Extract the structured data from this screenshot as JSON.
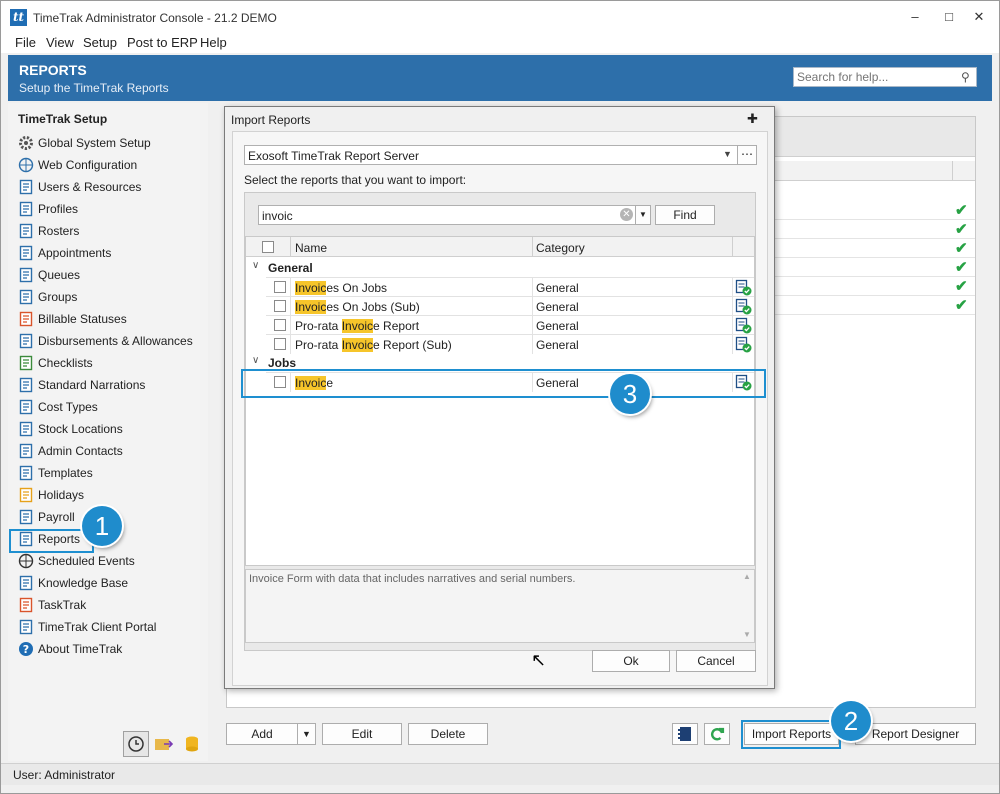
{
  "window": {
    "title": "TimeTrak Administrator Console - 21.2 DEMO",
    "logo": "tt"
  },
  "menu": [
    "File",
    "View",
    "Setup",
    "Post to ERP",
    "Help"
  ],
  "banner": {
    "title": "REPORTS",
    "subtitle": "Setup the TimeTrak Reports",
    "search_placeholder": "Search for help..."
  },
  "sidebar": {
    "title": "TimeTrak Setup",
    "items": [
      {
        "label": "Global System Setup",
        "icon": "gear-icon"
      },
      {
        "label": "Web Configuration",
        "icon": "globe-icon"
      },
      {
        "label": "Users & Resources",
        "icon": "users-icon"
      },
      {
        "label": "Profiles",
        "icon": "profile-icon"
      },
      {
        "label": "Rosters",
        "icon": "roster-icon"
      },
      {
        "label": "Appointments",
        "icon": "calendar-icon"
      },
      {
        "label": "Queues",
        "icon": "queue-icon"
      },
      {
        "label": "Groups",
        "icon": "groups-icon"
      },
      {
        "label": "Billable Statuses",
        "icon": "tag-icon"
      },
      {
        "label": "Disbursements & Allowances",
        "icon": "ledger-icon"
      },
      {
        "label": "Checklists",
        "icon": "checklist-icon"
      },
      {
        "label": "Standard Narrations",
        "icon": "narration-icon"
      },
      {
        "label": "Cost Types",
        "icon": "cost-icon"
      },
      {
        "label": "Stock Locations",
        "icon": "stock-icon"
      },
      {
        "label": "Admin Contacts",
        "icon": "contacts-icon"
      },
      {
        "label": "Templates",
        "icon": "template-icon"
      },
      {
        "label": "Holidays",
        "icon": "holiday-icon"
      },
      {
        "label": "Payroll",
        "icon": "payroll-icon"
      },
      {
        "label": "Reports",
        "icon": "report-icon"
      },
      {
        "label": "Scheduled Events",
        "icon": "clock-icon"
      },
      {
        "label": "Knowledge Base",
        "icon": "book-icon"
      },
      {
        "label": "TaskTrak",
        "icon": "task-icon"
      },
      {
        "label": "TimeTrak Client Portal",
        "icon": "portal-icon"
      },
      {
        "label": "About TimeTrak",
        "icon": "help-icon"
      }
    ]
  },
  "toolbar": {
    "add": "Add",
    "edit": "Edit",
    "delete": "Delete",
    "import_reports": "Import Reports",
    "report_designer": "Report Designer"
  },
  "status": "User: Administrator",
  "callouts": [
    "1",
    "2",
    "3"
  ],
  "dialog": {
    "title": "Import Reports",
    "source": "Exosoft TimeTrak Report Server",
    "instruction": "Select the reports that you want to import:",
    "search_value": "invoic",
    "find": "Find",
    "columns": {
      "name": "Name",
      "category": "Category"
    },
    "groups": [
      {
        "name": "General",
        "rows": [
          {
            "pre": "",
            "match": "Invoic",
            "post": "es On Jobs",
            "category": "General"
          },
          {
            "pre": "",
            "match": "Invoic",
            "post": "es On Jobs (Sub)",
            "category": "General"
          },
          {
            "pre": "Pro-rata ",
            "match": "Invoic",
            "post": "e Report",
            "category": "General"
          },
          {
            "pre": "Pro-rata ",
            "match": "Invoic",
            "post": "e Report (Sub)",
            "category": "General"
          }
        ]
      },
      {
        "name": "Jobs",
        "rows": [
          {
            "pre": "",
            "match": "Invoic",
            "post": "e",
            "category": "General"
          }
        ]
      }
    ],
    "description": "Invoice Form with data that includes narratives and serial numbers.",
    "ok": "Ok",
    "cancel": "Cancel"
  },
  "colors": {
    "banner": "#2d6faa",
    "highlight": "#1e8fd0",
    "match": "#f6c52a",
    "check": "#27a244"
  }
}
